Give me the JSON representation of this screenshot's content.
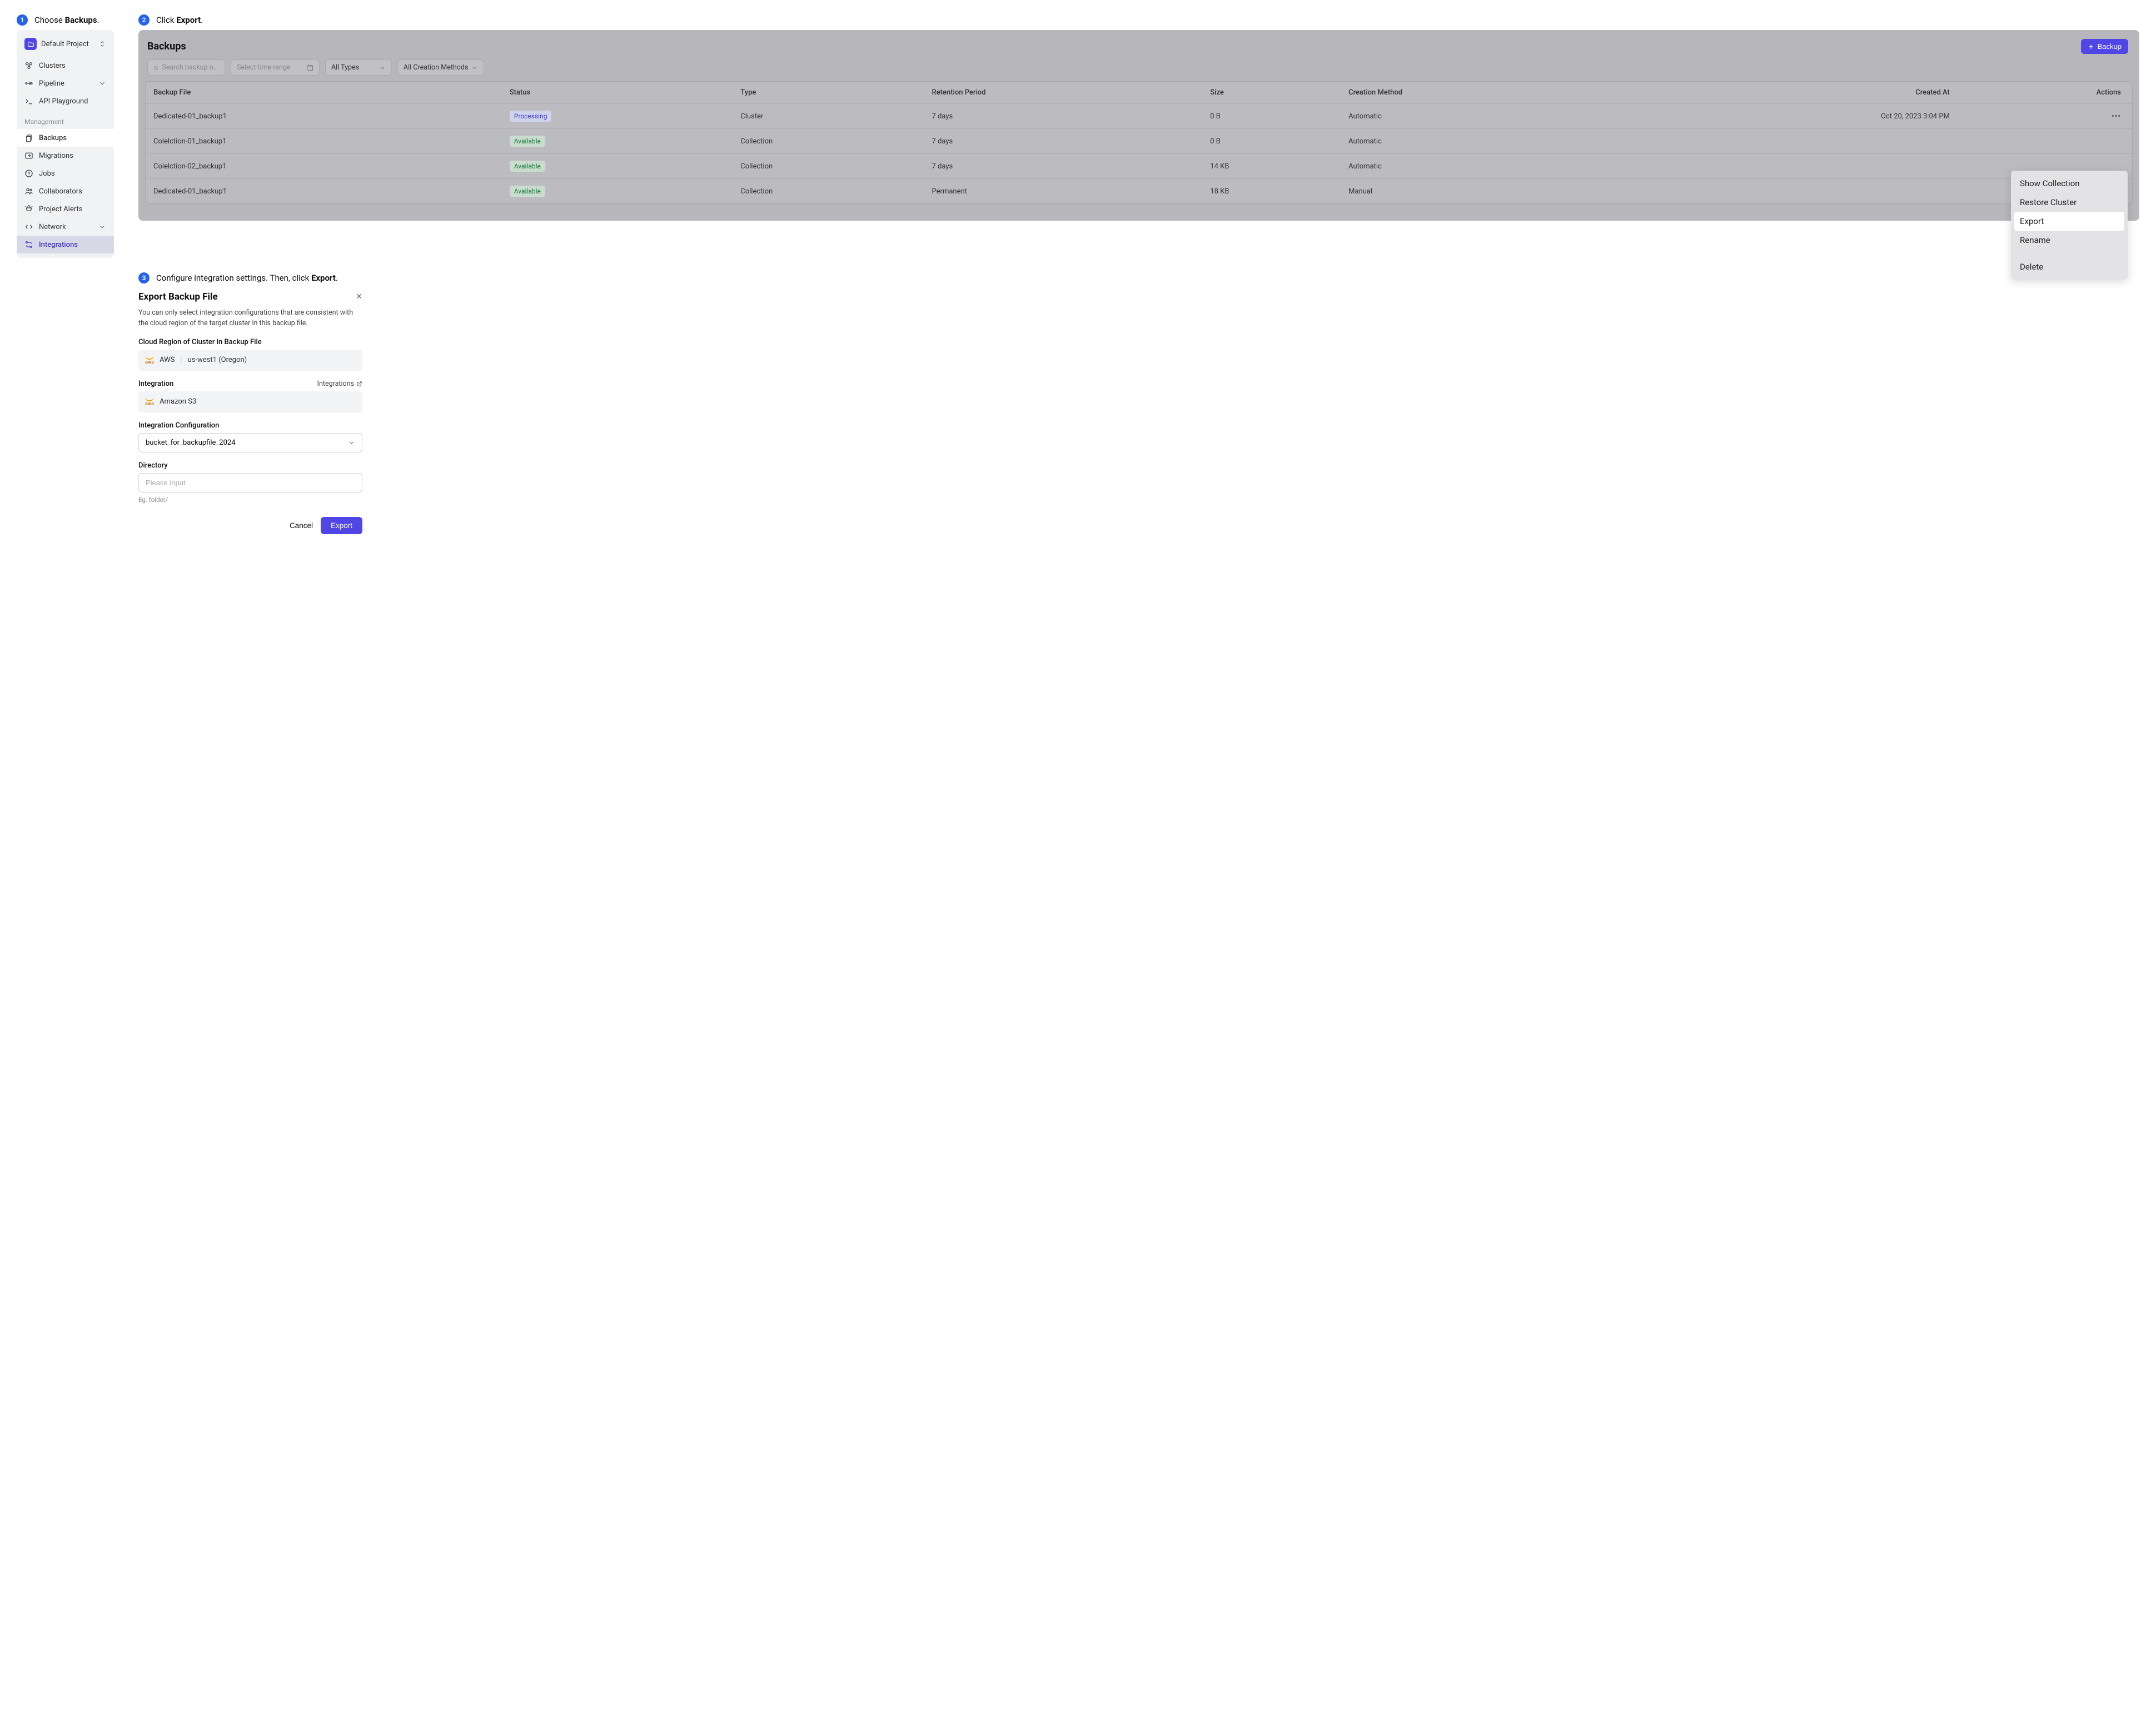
{
  "steps": {
    "s1_pre": "Choose ",
    "s1_b": "Backups",
    "s1_post": ".",
    "s2_pre": "Click ",
    "s2_b": "Export",
    "s2_post": ".",
    "s3_pre": "Configure integration settings. Then, click ",
    "s3_b": "Export",
    "s3_post": "."
  },
  "sidebar": {
    "project": "Default Project",
    "items_top": [
      {
        "label": "Clusters"
      },
      {
        "label": "Pipeline",
        "exp": true
      },
      {
        "label": "API Playground"
      }
    ],
    "mgmt_heading": "Management",
    "items_mgmt": [
      {
        "label": "Backups",
        "active": true
      },
      {
        "label": "Migrations"
      },
      {
        "label": "Jobs"
      },
      {
        "label": "Collaborators"
      },
      {
        "label": "Project Alerts"
      },
      {
        "label": "Network",
        "exp": true
      },
      {
        "label": "Integrations",
        "int": true
      }
    ]
  },
  "backups": {
    "title": "Backups",
    "backup_btn": "Backup",
    "search_ph": "Search backup or clus…",
    "date_ph": "Select time range",
    "types": "All Types",
    "methods": "All Creation Methods",
    "cols": [
      "Backup File",
      "Status",
      "Type",
      "Retention Period",
      "Size",
      "Creation Method",
      "Created At",
      "Actions"
    ],
    "rows": [
      {
        "file": "Dedicated-01_backup1",
        "status": "Processing",
        "scls": "processing",
        "type": "Cluster",
        "ret": "7 days",
        "size": "0 B",
        "method": "Automatic",
        "created": "Oct 20, 2023 3:04 PM",
        "dots": true
      },
      {
        "file": "Colelction-01_backup1",
        "status": "Available",
        "scls": "available",
        "type": "Collection",
        "ret": "7 days",
        "size": "0 B",
        "method": "Automatic",
        "created": "",
        "dots": false
      },
      {
        "file": "Colelction-02_backup1",
        "status": "Available",
        "scls": "available",
        "type": "Collection",
        "ret": "7 days",
        "size": "14 KB",
        "method": "Automatic",
        "created": "",
        "dots": false
      },
      {
        "file": "Dedicated-01_backup1",
        "status": "Available",
        "scls": "available",
        "type": "Collection",
        "ret": "Permanent",
        "size": "18 KB",
        "method": "Manual",
        "created": "",
        "dots": false
      }
    ],
    "menu": [
      "Show Collection",
      "Restore Cluster",
      "Export",
      "Rename",
      "Delete"
    ]
  },
  "export": {
    "title": "Export Backup File",
    "desc": "You can only select integration configurations that are consistent with the cloud region of the target cluster in this backup file.",
    "region_label": "Cloud Region of Cluster in Backup File",
    "region_provider": "AWS",
    "region_value": "us-west1 (Oregon)",
    "integration_label": "Integration",
    "integrations_link": "Integrations",
    "integration_value": "Amazon S3",
    "config_label": "Integration Configuration",
    "config_value": "bucket_for_backupfile_2024",
    "dir_label": "Directory",
    "dir_ph": "Please input",
    "dir_hint": "Eg. folder/",
    "cancel": "Cancel",
    "export_btn": "Export"
  }
}
